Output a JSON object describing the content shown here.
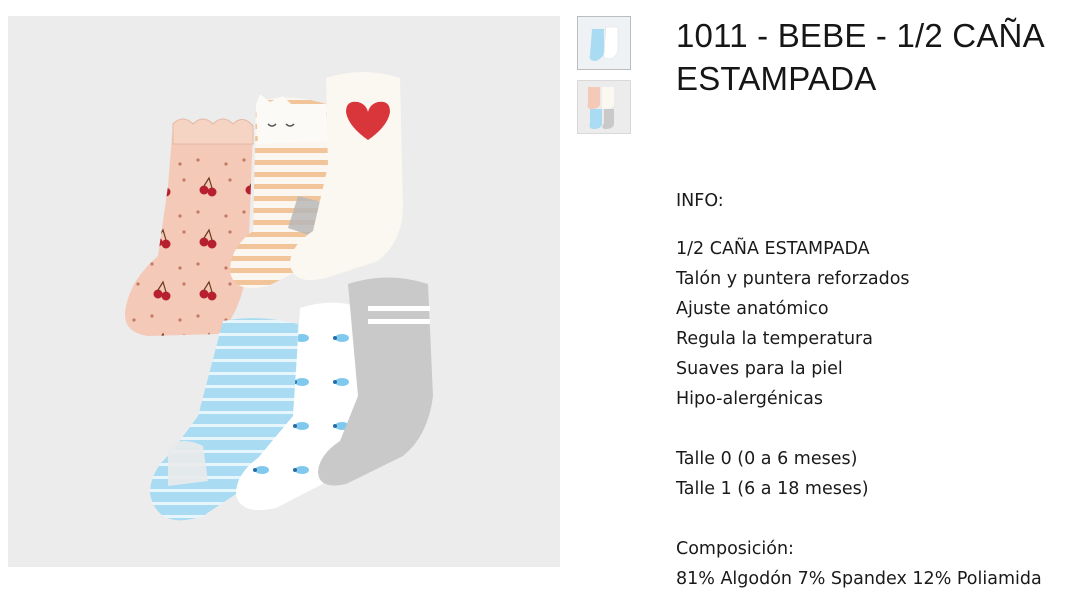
{
  "product": {
    "title": "1011 - BEBE - 1/2 CAÑA ESTAMPADA"
  },
  "gallery": {
    "main_image_alt": "Product photo of six baby socks",
    "thumbnails": [
      {
        "alt": "Thumbnail 1"
      },
      {
        "alt": "Thumbnail 2"
      }
    ]
  },
  "description": {
    "info_heading": "INFO:",
    "features": [
      "1/2 CAÑA ESTAMPADA",
      "Talón y puntera reforzados",
      "Ajuste anatómico",
      "Regula la temperatura",
      "Suaves para la piel",
      "Hipo-alergénicas"
    ],
    "sizes": [
      "Talle 0 (0 a 6 meses)",
      "Talle 1 (6 a 18 meses)"
    ],
    "composition_heading": "Composición:",
    "composition": "81% Algodón 7% Spandex 12% Poliamida"
  },
  "colors": {
    "image_bg": "#ececec",
    "sock_pink": "#f4c9b8",
    "sock_cream": "#fbf7f1",
    "sock_blue": "#a9dcf2",
    "sock_grey": "#c9c9c9",
    "cherry_red": "#b7202e"
  }
}
